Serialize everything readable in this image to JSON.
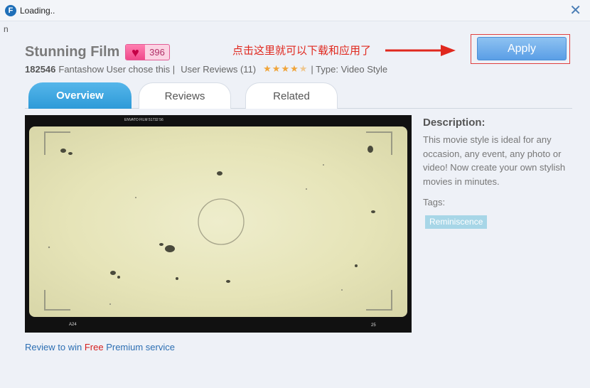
{
  "window": {
    "title": "Loading..",
    "app_icon_letter": "F",
    "stray_text": "n"
  },
  "style": {
    "name": "Stunning Film",
    "likes": "396",
    "users_count": "182546",
    "users_text": "Fantashow User chose this |",
    "reviews_text": "User Reviews (11)",
    "rating": 4.5,
    "type_text": "| Type: Video Style"
  },
  "annotation": {
    "note": "点击这里就可以下载和应用了"
  },
  "apply_label": "Apply",
  "tabs": [
    {
      "label": "Overview",
      "active": true
    },
    {
      "label": "Reviews",
      "active": false
    },
    {
      "label": "Related",
      "active": false
    }
  ],
  "preview": {
    "film_top": "ENVATO FILM 51732 56",
    "film_bottom_left": "A24",
    "film_bottom_right": "25"
  },
  "description": {
    "title": "Description:",
    "text": "This movie style is ideal for any occasion, any event, any photo or video! Now create your own stylish movies in minutes.",
    "tags_label": "Tags:",
    "tags": [
      "Reminiscence"
    ]
  },
  "review_promo": {
    "before": "Review to win",
    "free": "Free",
    "after": "Premium service"
  },
  "colors": {
    "accent": "#2d9ad8",
    "annotation": "#e0281e",
    "apply": "#5a9ee6",
    "like": "#f0488a"
  }
}
